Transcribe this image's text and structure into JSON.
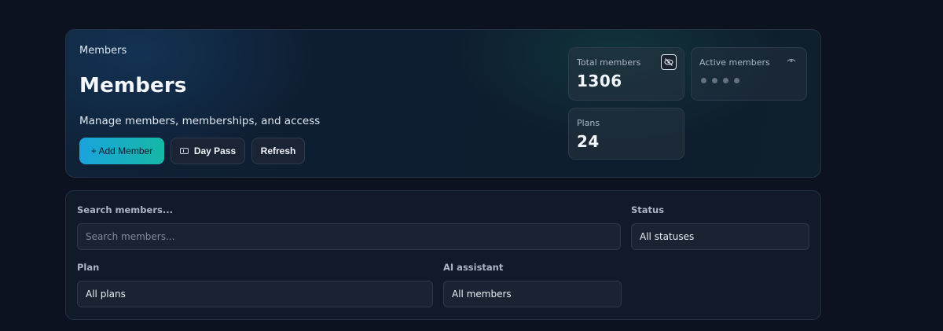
{
  "header": {
    "breadcrumb": "Members",
    "title": "Members",
    "subtitle": "Manage members, memberships, and access"
  },
  "actions": {
    "add_member": "+ Add Member",
    "day_pass": "Day Pass",
    "refresh": "Refresh"
  },
  "stats": {
    "total_members": {
      "label": "Total members",
      "value": "1306",
      "icon": "eye-off-icon"
    },
    "active_members": {
      "label": "Active members",
      "value_hidden": true,
      "icon": "eye-icon"
    },
    "plans": {
      "label": "Plans",
      "value": "24"
    }
  },
  "filters": {
    "search": {
      "label": "Search members...",
      "placeholder": "Search members...",
      "value": ""
    },
    "status": {
      "label": "Status",
      "selected": "All statuses"
    },
    "plan": {
      "label": "Plan",
      "selected": "All plans"
    },
    "ai_assistant": {
      "label": "AI assistant",
      "selected": "All members"
    }
  },
  "colors": {
    "background": "#0c1220",
    "accent_start": "#1aa3dd",
    "accent_end": "#16b8a6"
  }
}
